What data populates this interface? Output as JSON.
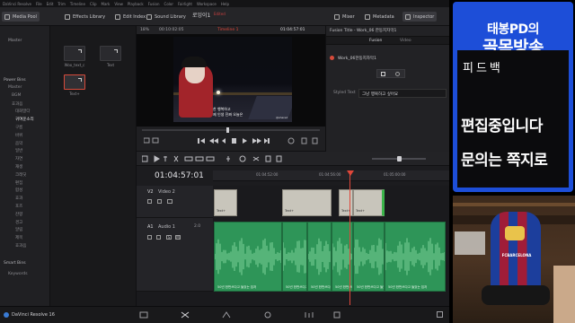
{
  "menubar": {
    "items": [
      "DaVinci Resolve",
      "File",
      "Edit",
      "Trim",
      "Timeline",
      "Clip",
      "Mark",
      "View",
      "Playback",
      "Fusion",
      "Color",
      "Fairlight",
      "Workspace",
      "Help"
    ]
  },
  "toolbar": {
    "media_pool": "Media Pool",
    "effects_library": "Effects Library",
    "edit_index": "Edit Index",
    "sound_library": "Sound Library",
    "project_title": "로잉이1",
    "project_status": "Edited",
    "mixer": "Mixer",
    "metadata": "Metadata",
    "inspector": "Inspector"
  },
  "left_panel": {
    "master_label": "Master",
    "power_bins_label": "Power Bins",
    "power_bins_items": [
      "Master",
      "BGM",
      "효과음",
      "대화말다",
      "귀여운소리",
      "구름",
      "바위",
      "음악",
      "일반",
      "자연",
      "재생",
      "크레딧",
      "편집",
      "합성",
      "효과",
      "포즈",
      "잔향",
      "경고",
      "알림",
      "제목",
      "효과음"
    ],
    "smart_bins_label": "Smart Bins",
    "smart_bins_items": [
      "Keywords"
    ]
  },
  "media_pool": {
    "items": [
      {
        "label": "Woo_text_c"
      },
      {
        "label": "Text"
      },
      {
        "label": "Text+"
      }
    ]
  },
  "viewer": {
    "zoom": "18%",
    "source_timecode": "00:10:02:05",
    "timeline_name": "Timeline 1",
    "record_timecode": "01:04:57:01",
    "caption_line1": "찬 행복하고",
    "caption_line2": "제 인생 진짜 오늘은",
    "watermark": "@shared"
  },
  "inspector": {
    "header": "Fusion Title - Work_06 한동지자막1",
    "tab_fusion": "Fusion",
    "tab_video": "Video",
    "node_name": "Work_06한동지자막1",
    "styled_text_label": "Styled Text",
    "styled_text_value": "그냥 행복하고 싶어요"
  },
  "timeline": {
    "timecode": "01:04:57:01",
    "ruler_labels": [
      "01:04:52:00",
      "01:04:56:00",
      "01:05:00:00"
    ],
    "video_track": {
      "id": "V2",
      "name": "Video 2"
    },
    "audio_track": {
      "id": "A1",
      "name": "Audio 1",
      "level": "2.0"
    },
    "video_clips": [
      {
        "label": "Text+"
      },
      {
        "label": "Text+"
      },
      {
        "label": "Text+"
      },
      {
        "label": "Text+"
      }
    ],
    "audio_clips": [
      {
        "label": "50년 한번쓰다고 들었는 집저"
      },
      {
        "label": "50년 한번쓰다고 들었는 집저"
      },
      {
        "label": "50년 한번쓰다고 들었는 집저"
      },
      {
        "label": "50년 한번쓰다고 들었는 집저"
      },
      {
        "label": "50년 한번쓰다고 들었는 집저"
      },
      {
        "label": "50년 한번쓰다고 들었는 집저"
      }
    ]
  },
  "bottom": {
    "app_name": "DaVinci Resolve 16"
  },
  "overlay": {
    "brand_top": "태봉PD의",
    "brand_bottom": "골목방송",
    "feedback": "피드백",
    "notice_line1": "편집중입니다",
    "notice_line2": "문의는 쪽지로",
    "jersey_text": "FCBARCELONA"
  },
  "colors": {
    "accent_red": "#d64b3b",
    "clip_video": "#c8c5bb",
    "clip_audio": "#2e9558",
    "playhead": "#e0473a",
    "banner_blue": "#1d4ed8"
  }
}
